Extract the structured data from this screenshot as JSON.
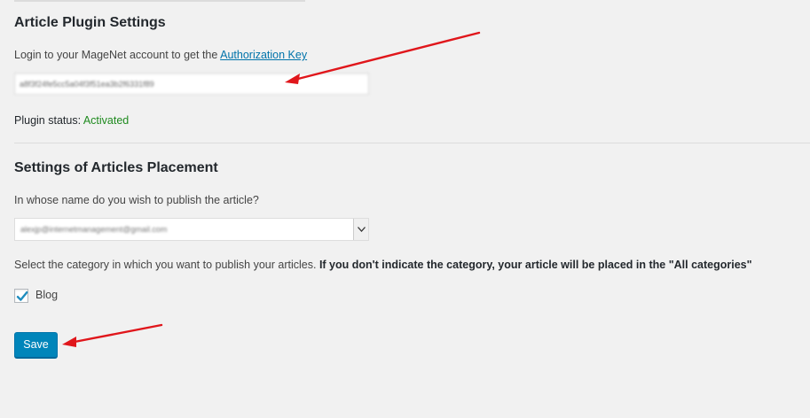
{
  "plugin_settings": {
    "title": "Article Plugin Settings",
    "login_prefix": "Login to your MageNet account to get the ",
    "login_link": "Authorization Key",
    "key_value": "a8f3f24fe5cc5a04f3f51ea3b2f6331f89",
    "status_label": "Plugin status: ",
    "status_value": "Activated",
    "status_color": "#1e8a1e"
  },
  "placement_settings": {
    "title": "Settings of Articles Placement",
    "author_question": "In whose name do you wish to publish the article?",
    "author_selected": "alexjp@internetmanagement@gmail.com",
    "category_prompt": "Select the category in which you want to publish your articles. ",
    "category_note": "If you don't indicate the category, your article will be placed in the \"All categories\"",
    "categories": [
      {
        "label": "Blog",
        "checked": true
      }
    ],
    "save_label": "Save"
  },
  "colors": {
    "accent": "#0085ba",
    "link": "#0073aa",
    "annotation_arrow": "#e0161b"
  }
}
